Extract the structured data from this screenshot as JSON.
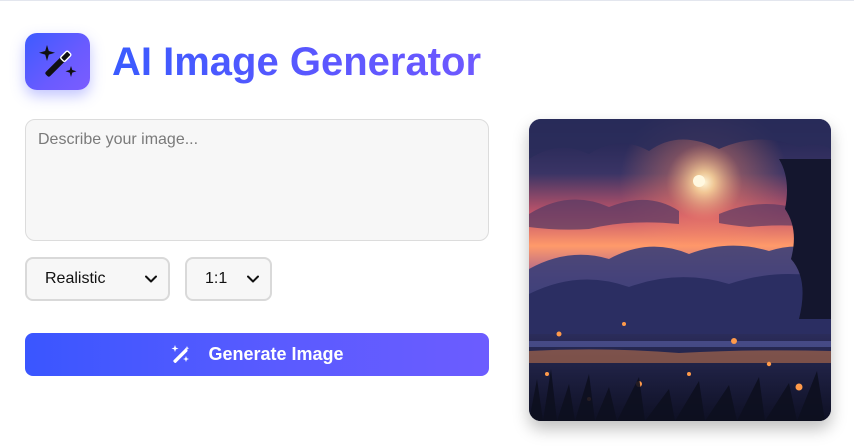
{
  "header": {
    "title": "AI Image Generator",
    "logo_icon": "magic-wand-sparkles-icon"
  },
  "prompt": {
    "placeholder": "Describe your image...",
    "value": ""
  },
  "controls": {
    "style_select": {
      "value": "Realistic"
    },
    "ratio_select": {
      "value": "1:1"
    }
  },
  "generate_button": {
    "label": "Generate Image",
    "icon": "magic-wand-icon"
  },
  "preview": {
    "alt_kind": "generated-image"
  },
  "colors": {
    "accent_start": "#3a56ff",
    "accent_end": "#6c5cff"
  }
}
